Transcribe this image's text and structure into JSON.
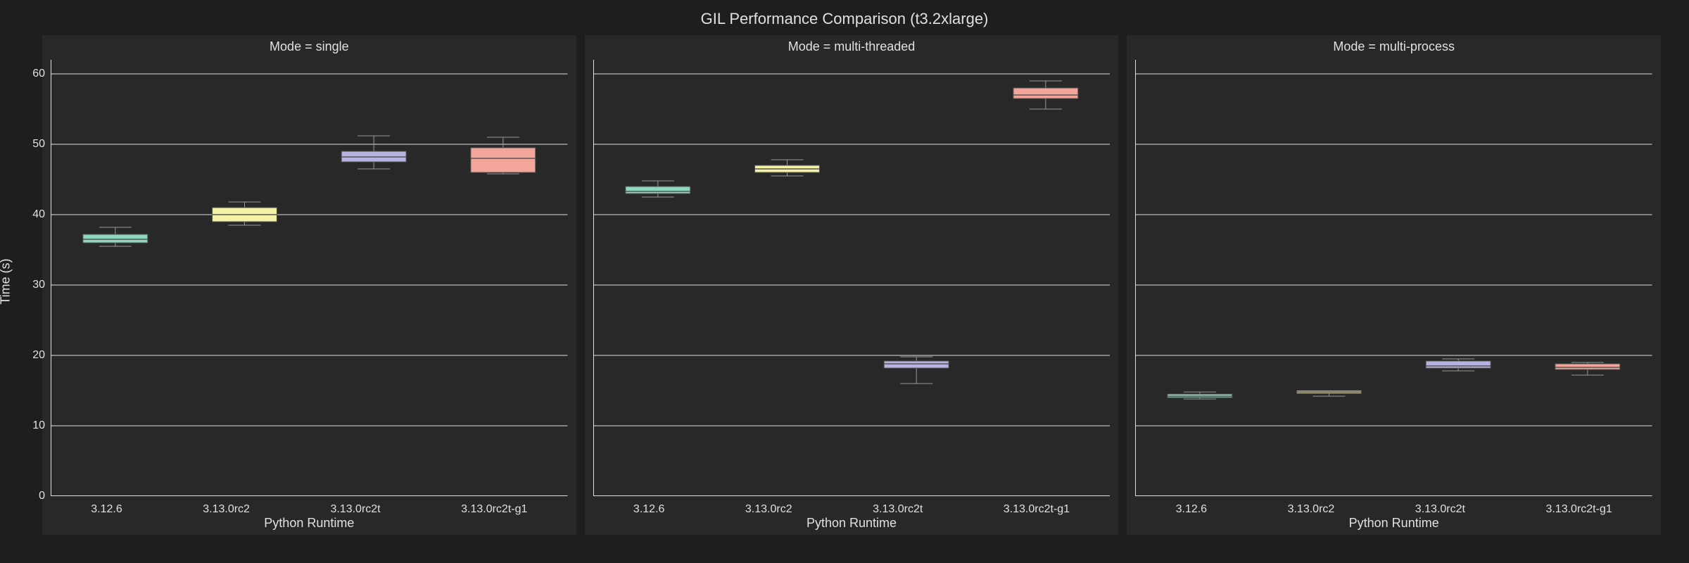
{
  "title": "GIL Performance Comparison (t3.2xlarge)",
  "ylabel": "Time (s)",
  "xlabel": "Python Runtime",
  "ylim": [
    0,
    62
  ],
  "yticks": [
    0,
    10,
    20,
    30,
    40,
    50,
    60
  ],
  "categories": [
    "3.12.6",
    "3.13.0rc2",
    "3.13.0rc2t",
    "3.13.0rc2t-g1"
  ],
  "colors": {
    "3.12.6": "#8fd6c0",
    "3.13.0rc2": "#f6f3a6",
    "3.13.0rc2t": "#b7b3e0",
    "3.13.0rc2t-g1": "#f4a59a"
  },
  "panels": [
    {
      "mode": "single",
      "title": "Mode = single"
    },
    {
      "mode": "multi-threaded",
      "title": "Mode = multi-threaded"
    },
    {
      "mode": "multi-process",
      "title": "Mode = multi-process"
    }
  ],
  "chart_data": [
    {
      "type": "boxplot",
      "mode": "single",
      "title": "Mode = single",
      "xlabel": "Python Runtime",
      "ylabel": "Time (s)",
      "ylim": [
        0,
        62
      ],
      "categories": [
        "3.12.6",
        "3.13.0rc2",
        "3.13.0rc2t",
        "3.13.0rc2t-g1"
      ],
      "series": [
        {
          "name": "3.12.6",
          "q1": 36.0,
          "median": 36.5,
          "q3": 37.2,
          "whisker_low": 35.5,
          "whisker_high": 38.2
        },
        {
          "name": "3.13.0rc2",
          "q1": 39.0,
          "median": 40.0,
          "q3": 41.0,
          "whisker_low": 38.5,
          "whisker_high": 41.8
        },
        {
          "name": "3.13.0rc2t",
          "q1": 47.5,
          "median": 48.2,
          "q3": 49.0,
          "whisker_low": 46.5,
          "whisker_high": 51.2
        },
        {
          "name": "3.13.0rc2t-g1",
          "q1": 46.0,
          "median": 48.0,
          "q3": 49.5,
          "whisker_low": 45.8,
          "whisker_high": 51.0
        }
      ]
    },
    {
      "type": "boxplot",
      "mode": "multi-threaded",
      "title": "Mode = multi-threaded",
      "xlabel": "Python Runtime",
      "ylabel": "Time (s)",
      "ylim": [
        0,
        62
      ],
      "categories": [
        "3.12.6",
        "3.13.0rc2",
        "3.13.0rc2t",
        "3.13.0rc2t-g1"
      ],
      "series": [
        {
          "name": "3.12.6",
          "q1": 43.0,
          "median": 43.3,
          "q3": 44.0,
          "whisker_low": 42.5,
          "whisker_high": 44.8
        },
        {
          "name": "3.13.0rc2",
          "q1": 46.0,
          "median": 46.5,
          "q3": 47.0,
          "whisker_low": 45.5,
          "whisker_high": 47.8
        },
        {
          "name": "3.13.0rc2t",
          "q1": 18.2,
          "median": 18.8,
          "q3": 19.2,
          "whisker_low": 16.0,
          "whisker_high": 19.8
        },
        {
          "name": "3.13.0rc2t-g1",
          "q1": 56.5,
          "median": 57.0,
          "q3": 58.0,
          "whisker_low": 55.0,
          "whisker_high": 59.0
        }
      ]
    },
    {
      "type": "boxplot",
      "mode": "multi-process",
      "title": "Mode = multi-process",
      "xlabel": "Python Runtime",
      "ylabel": "Time (s)",
      "ylim": [
        0,
        62
      ],
      "categories": [
        "3.12.6",
        "3.13.0rc2",
        "3.13.0rc2t",
        "3.13.0rc2t-g1"
      ],
      "series": [
        {
          "name": "3.12.6",
          "q1": 14.0,
          "median": 14.2,
          "q3": 14.5,
          "whisker_low": 13.8,
          "whisker_high": 14.8
        },
        {
          "name": "3.13.0rc2",
          "q1": 14.6,
          "median": 14.8,
          "q3": 15.0,
          "whisker_low": 14.2,
          "whisker_high": 15.0
        },
        {
          "name": "3.13.0rc2t",
          "q1": 18.2,
          "median": 18.5,
          "q3": 19.2,
          "whisker_low": 17.8,
          "whisker_high": 19.5
        },
        {
          "name": "3.13.0rc2t-g1",
          "q1": 18.0,
          "median": 18.3,
          "q3": 18.8,
          "whisker_low": 17.2,
          "whisker_high": 19.0
        }
      ]
    }
  ]
}
